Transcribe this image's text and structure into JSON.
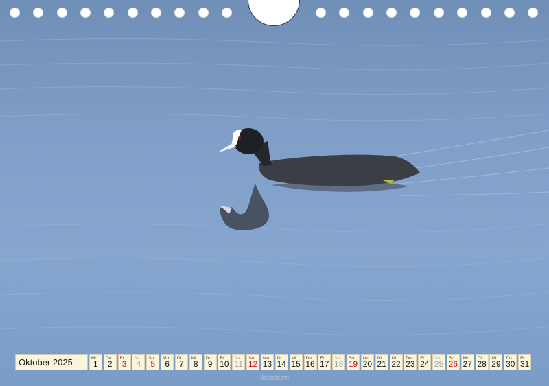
{
  "calendar": {
    "month_label": "Oktober 2025",
    "days": [
      {
        "wd": "Mi",
        "n": "1",
        "t": "wd"
      },
      {
        "wd": "Do",
        "n": "2",
        "t": "wd"
      },
      {
        "wd": "Fr",
        "n": "3",
        "t": "sun"
      },
      {
        "wd": "Sa",
        "n": "4",
        "t": "sat"
      },
      {
        "wd": "So",
        "n": "5",
        "t": "sun"
      },
      {
        "wd": "Mo",
        "n": "6",
        "t": "wd"
      },
      {
        "wd": "Di",
        "n": "7",
        "t": "wd"
      },
      {
        "wd": "Mi",
        "n": "8",
        "t": "wd"
      },
      {
        "wd": "Do",
        "n": "9",
        "t": "wd"
      },
      {
        "wd": "Fr",
        "n": "10",
        "t": "wd"
      },
      {
        "wd": "Sa",
        "n": "11",
        "t": "sat"
      },
      {
        "wd": "So",
        "n": "12",
        "t": "sun"
      },
      {
        "wd": "Mo",
        "n": "13",
        "t": "wd"
      },
      {
        "wd": "Di",
        "n": "14",
        "t": "wd"
      },
      {
        "wd": "Mi",
        "n": "15",
        "t": "wd"
      },
      {
        "wd": "Do",
        "n": "16",
        "t": "wd"
      },
      {
        "wd": "Fr",
        "n": "17",
        "t": "wd"
      },
      {
        "wd": "Sa",
        "n": "18",
        "t": "sat"
      },
      {
        "wd": "So",
        "n": "19",
        "t": "sun"
      },
      {
        "wd": "Mo",
        "n": "20",
        "t": "wd"
      },
      {
        "wd": "Di",
        "n": "21",
        "t": "wd"
      },
      {
        "wd": "Mi",
        "n": "22",
        "t": "wd"
      },
      {
        "wd": "Do",
        "n": "23",
        "t": "wd"
      },
      {
        "wd": "Fr",
        "n": "24",
        "t": "wd"
      },
      {
        "wd": "Sa",
        "n": "25",
        "t": "sat"
      },
      {
        "wd": "So",
        "n": "26",
        "t": "sun"
      },
      {
        "wd": "Mo",
        "n": "27",
        "t": "wd"
      },
      {
        "wd": "Di",
        "n": "28",
        "t": "wd"
      },
      {
        "wd": "Mi",
        "n": "29",
        "t": "wd"
      },
      {
        "wd": "Do",
        "n": "30",
        "t": "wd"
      },
      {
        "wd": "Fr",
        "n": "31",
        "t": "wd"
      }
    ]
  },
  "caption": "Blässhuhn",
  "colors": {
    "water": "#7f9fc8",
    "cell": "#fbf5dc",
    "sunday": "#d0161b",
    "saturday": "#a8a8a8"
  },
  "photo": {
    "subject": "coot-on-water"
  }
}
